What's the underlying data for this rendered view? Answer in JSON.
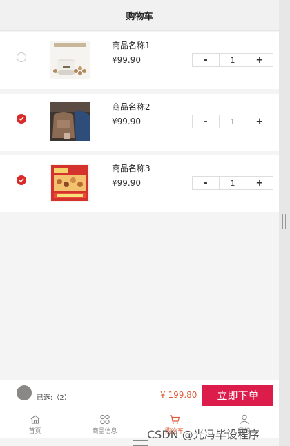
{
  "header": {
    "title": "购物车"
  },
  "cart": {
    "items": [
      {
        "name": "商品名称1",
        "price": "¥99.90",
        "qty": "1",
        "checked": false,
        "image": "rice-cooker"
      },
      {
        "name": "商品名称2",
        "price": "¥99.90",
        "qty": "1",
        "checked": true,
        "image": "bag"
      },
      {
        "name": "商品名称3",
        "price": "¥99.90",
        "qty": "1",
        "checked": true,
        "image": "snack-box"
      }
    ],
    "minus": "-",
    "plus": "+"
  },
  "checkout": {
    "selected_label": "已选:（2）",
    "total": "¥ 199.80",
    "order_button": "立即下单"
  },
  "tabs": [
    {
      "label": "首页",
      "icon": "home-icon",
      "active": false
    },
    {
      "label": "商品信息",
      "icon": "grid-icon",
      "active": false
    },
    {
      "label": "购物车",
      "icon": "cart-icon",
      "active": true
    },
    {
      "label": "我的",
      "icon": "user-icon",
      "active": false
    }
  ],
  "watermark": "CSDN @光冯毕设程序",
  "colors": {
    "accent": "#dc1c4a",
    "price_red": "#e05a36",
    "check_red": "#d92b2b"
  }
}
